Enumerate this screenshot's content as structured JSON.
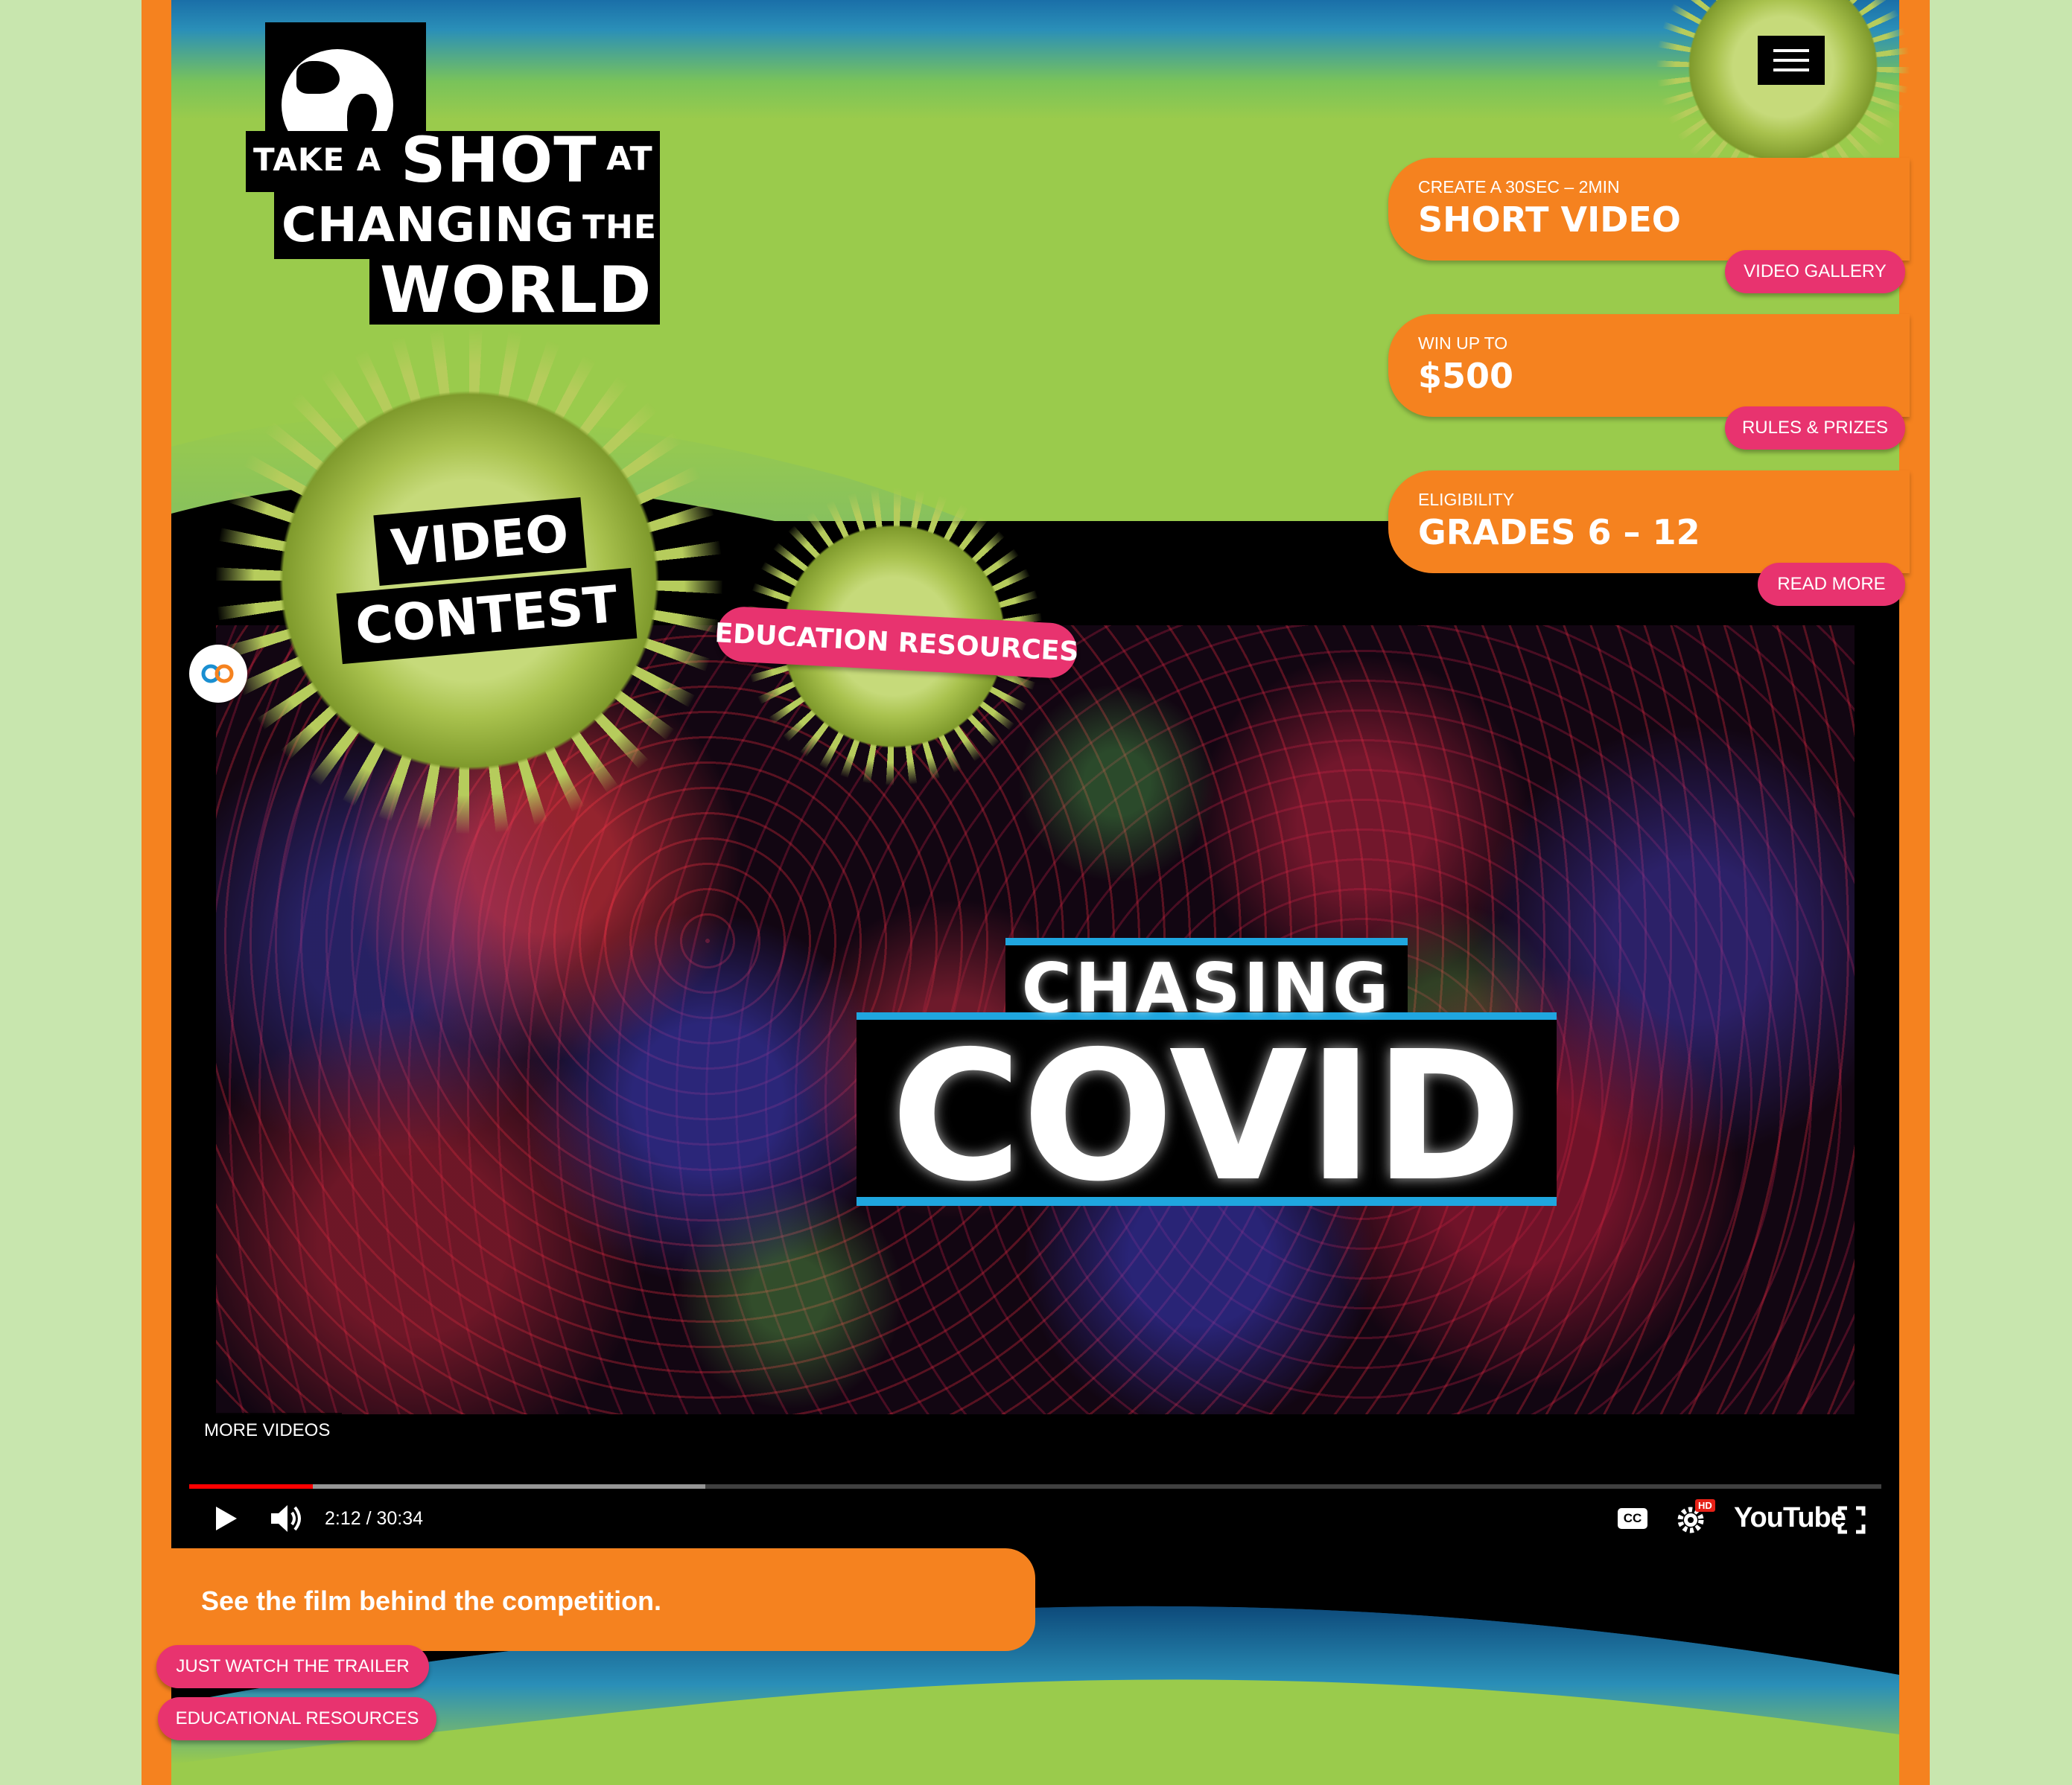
{
  "logo": {
    "take_a": "TAKE A",
    "shot": "SHOT",
    "at": "AT",
    "changing": "CHANGING",
    "the": "THE",
    "world": "WORLD"
  },
  "hero": {
    "video_contest_line1": "VIDEO",
    "video_contest_line2": "CONTEST",
    "education_resources": "EDUCATION RESOURCES"
  },
  "cards": [
    {
      "small": "CREATE A 30SEC – 2MIN",
      "big": "SHORT VIDEO",
      "button": "VIDEO GALLERY"
    },
    {
      "small": "WIN UP TO",
      "big": "$500",
      "button": "RULES & PRIZES"
    },
    {
      "small": "ELIGIBILITY",
      "big": "GRADES 6 – 12",
      "button": "READ MORE"
    }
  ],
  "video": {
    "title_top": "CHASING",
    "title_bottom": "COVID",
    "more_videos": "MORE VIDEOS",
    "time": "2:12 / 30:34",
    "progress_played": 0.073,
    "progress_loaded": 0.305,
    "youtube_label": "YouTube",
    "hd_badge": "HD",
    "cc_label": "CC"
  },
  "footer": {
    "blurb": "See the film behind the competition.",
    "trailer_button": "JUST WATCH THE TRAILER",
    "resources_button": "EDUCATIONAL RESOURCES"
  },
  "colors": {
    "orange": "#f5821f",
    "pink": "#e8336f",
    "green": "#9acb4c",
    "blue_accent": "#1fa6df",
    "progress_red": "#ff0000"
  },
  "icons": [
    "menu-icon",
    "play-icon",
    "volume-icon",
    "captions-icon",
    "settings-icon",
    "fullscreen-icon",
    "globe-icon",
    "virus-icon"
  ]
}
